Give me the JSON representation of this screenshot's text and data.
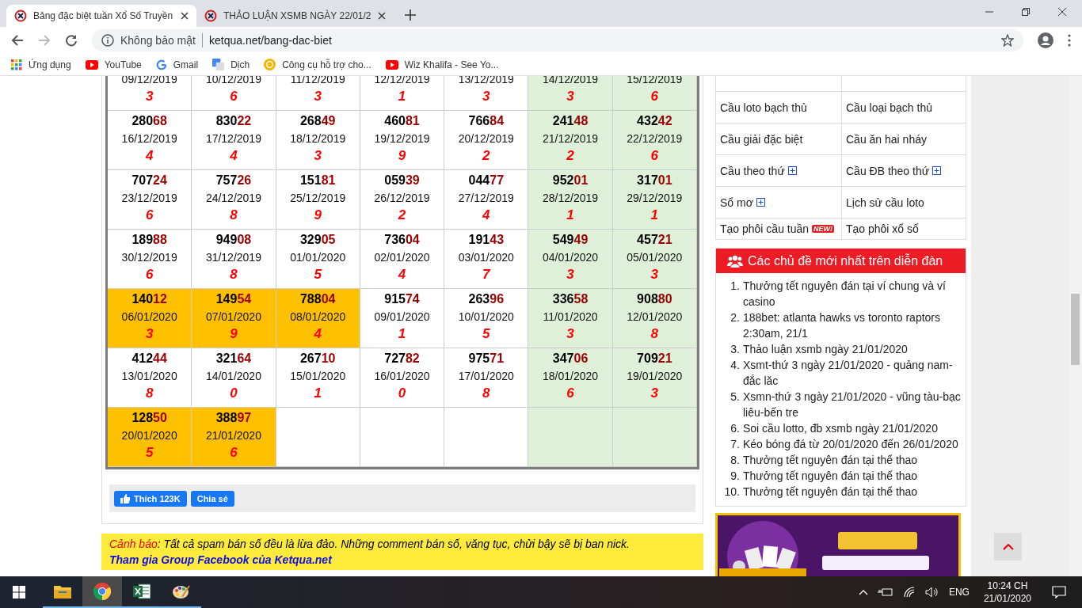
{
  "browser": {
    "tabs": [
      {
        "title": "Bảng đặc biệt tuần Xổ Số Truyền",
        "selected": true
      },
      {
        "title": "THẢO LUẬN XSMB NGÀY 22/01/2",
        "selected": false
      }
    ],
    "security": "Không bảo mật",
    "url": "ketqua.net/bang-dac-biet",
    "bookmarks": [
      {
        "kind": "apps",
        "label": "Ứng dụng"
      },
      {
        "kind": "youtube",
        "label": "YouTube"
      },
      {
        "kind": "google",
        "label": "Gmail"
      },
      {
        "kind": "translate",
        "label": "Dịch"
      },
      {
        "kind": "xs",
        "label": "Công cụ hỗ trợ cho..."
      },
      {
        "kind": "youtube",
        "label": "Wiz Khalifa - See Yo..."
      }
    ]
  },
  "results": {
    "rows": [
      {
        "cells": [
          {
            "date": "09/12/2019",
            "digit": "3",
            "highlighted": false,
            "weekend": false
          },
          {
            "date": "10/12/2019",
            "digit": "6",
            "highlighted": false,
            "weekend": false
          },
          {
            "date": "11/12/2019",
            "digit": "3",
            "highlighted": false,
            "weekend": false
          },
          {
            "date": "12/12/2019",
            "digit": "1",
            "highlighted": false,
            "weekend": false
          },
          {
            "date": "13/12/2019",
            "digit": "3",
            "highlighted": false,
            "weekend": false
          },
          {
            "date": "14/12/2019",
            "digit": "3",
            "highlighted": false,
            "weekend": true
          },
          {
            "date": "15/12/2019",
            "digit": "6",
            "highlighted": false,
            "weekend": true
          }
        ]
      },
      {
        "cells": [
          {
            "number": "28068",
            "date": "16/12/2019",
            "digit": "4",
            "highlighted": false,
            "weekend": false
          },
          {
            "number": "83022",
            "date": "17/12/2019",
            "digit": "4",
            "highlighted": false,
            "weekend": false
          },
          {
            "number": "26849",
            "date": "18/12/2019",
            "digit": "3",
            "highlighted": false,
            "weekend": false
          },
          {
            "number": "46081",
            "date": "19/12/2019",
            "digit": "9",
            "highlighted": false,
            "weekend": false
          },
          {
            "number": "76684",
            "date": "20/12/2019",
            "digit": "2",
            "highlighted": false,
            "weekend": false
          },
          {
            "number": "24148",
            "date": "21/12/2019",
            "digit": "2",
            "highlighted": false,
            "weekend": true
          },
          {
            "number": "43242",
            "date": "22/12/2019",
            "digit": "6",
            "highlighted": false,
            "weekend": true
          }
        ]
      },
      {
        "cells": [
          {
            "number": "70724",
            "date": "23/12/2019",
            "digit": "6",
            "highlighted": false,
            "weekend": false
          },
          {
            "number": "75726",
            "date": "24/12/2019",
            "digit": "8",
            "highlighted": false,
            "weekend": false
          },
          {
            "number": "15181",
            "date": "25/12/2019",
            "digit": "9",
            "highlighted": false,
            "weekend": false
          },
          {
            "number": "05939",
            "date": "26/12/2019",
            "digit": "2",
            "highlighted": false,
            "weekend": false
          },
          {
            "number": "04477",
            "date": "27/12/2019",
            "digit": "4",
            "highlighted": false,
            "weekend": false
          },
          {
            "number": "95201",
            "date": "28/12/2019",
            "digit": "1",
            "highlighted": false,
            "weekend": true
          },
          {
            "number": "31701",
            "date": "29/12/2019",
            "digit": "1",
            "highlighted": false,
            "weekend": true
          }
        ]
      },
      {
        "cells": [
          {
            "number": "18988",
            "date": "30/12/2019",
            "digit": "6",
            "highlighted": false,
            "weekend": false
          },
          {
            "number": "94908",
            "date": "31/12/2019",
            "digit": "8",
            "highlighted": false,
            "weekend": false
          },
          {
            "number": "32905",
            "date": "01/01/2020",
            "digit": "5",
            "highlighted": false,
            "weekend": false
          },
          {
            "number": "73604",
            "date": "02/01/2020",
            "digit": "4",
            "highlighted": false,
            "weekend": false
          },
          {
            "number": "19143",
            "date": "03/01/2020",
            "digit": "7",
            "highlighted": false,
            "weekend": false
          },
          {
            "number": "54949",
            "date": "04/01/2020",
            "digit": "3",
            "highlighted": false,
            "weekend": true
          },
          {
            "number": "45721",
            "date": "05/01/2020",
            "digit": "3",
            "highlighted": false,
            "weekend": true
          }
        ]
      },
      {
        "cells": [
          {
            "number": "14012",
            "date": "06/01/2020",
            "digit": "3",
            "highlighted": true,
            "weekend": false
          },
          {
            "number": "14954",
            "date": "07/01/2020",
            "digit": "9",
            "highlighted": true,
            "weekend": false
          },
          {
            "number": "78804",
            "date": "08/01/2020",
            "digit": "4",
            "highlighted": true,
            "weekend": false
          },
          {
            "number": "91574",
            "date": "09/01/2020",
            "digit": "1",
            "highlighted": false,
            "weekend": false
          },
          {
            "number": "26396",
            "date": "10/01/2020",
            "digit": "5",
            "highlighted": false,
            "weekend": false
          },
          {
            "number": "33658",
            "date": "11/01/2020",
            "digit": "3",
            "highlighted": false,
            "weekend": true
          },
          {
            "number": "90880",
            "date": "12/01/2020",
            "digit": "8",
            "highlighted": false,
            "weekend": true
          }
        ]
      },
      {
        "cells": [
          {
            "number": "41244",
            "date": "13/01/2020",
            "digit": "8",
            "highlighted": false,
            "weekend": false
          },
          {
            "number": "32164",
            "date": "14/01/2020",
            "digit": "0",
            "highlighted": false,
            "weekend": false
          },
          {
            "number": "26710",
            "date": "15/01/2020",
            "digit": "1",
            "highlighted": false,
            "weekend": false
          },
          {
            "number": "72782",
            "date": "16/01/2020",
            "digit": "0",
            "highlighted": false,
            "weekend": false
          },
          {
            "number": "97571",
            "date": "17/01/2020",
            "digit": "8",
            "highlighted": false,
            "weekend": false
          },
          {
            "number": "34706",
            "date": "18/01/2020",
            "digit": "6",
            "highlighted": false,
            "weekend": true
          },
          {
            "number": "70921",
            "date": "19/01/2020",
            "digit": "3",
            "highlighted": false,
            "weekend": true
          }
        ]
      },
      {
        "cells": [
          {
            "number": "12850",
            "date": "20/01/2020",
            "digit": "5",
            "highlighted": true,
            "weekend": false
          },
          {
            "number": "38897",
            "date": "21/01/2020",
            "digit": "6",
            "highlighted": true,
            "weekend": false
          },
          {
            "highlighted": false,
            "weekend": false
          },
          {
            "highlighted": false,
            "weekend": false
          },
          {
            "highlighted": false,
            "weekend": false
          },
          {
            "highlighted": false,
            "weekend": true
          },
          {
            "highlighted": false,
            "weekend": true
          }
        ]
      }
    ]
  },
  "share_bar": {
    "like": "Thích 123K",
    "share": "Chia sẻ"
  },
  "warning": {
    "label": "Cảnh báo",
    "text": ": Tất cả spam bán số đều là lừa đảo. Những comment bán số, văng tục, chửi bậy sẽ bị ban nick.",
    "link": "Tham gia Group Facebook của Ketqua.net"
  },
  "sidebar": {
    "menu": [
      [
        {
          "label": "Cầu loto bạch thủ",
          "expandable": false
        },
        {
          "label": "Cầu loại bạch thủ",
          "expandable": false
        }
      ],
      [
        {
          "label": "Cầu giải đặc biệt",
          "expandable": false
        },
        {
          "label": "Cầu ăn hai nháy",
          "expandable": false
        }
      ],
      [
        {
          "label": "Cầu theo thứ",
          "expandable": true
        },
        {
          "label": "Cầu ĐB theo thứ",
          "expandable": true
        }
      ],
      [
        {
          "label": "Sổ mơ",
          "expandable": true
        },
        {
          "label": "Lịch sử cầu loto",
          "expandable": false
        }
      ],
      [
        {
          "label": "Tạo phôi cầu tuần",
          "expandable": false,
          "badge": "NEW!"
        },
        {
          "label": "Tạo phôi xổ số",
          "expandable": false
        }
      ]
    ],
    "forum": {
      "title": "Các chủ đề mới nhất trên diễn đàn",
      "items": [
        {
          "number": "1.",
          "text": "Thưởng tết nguyên đán tại ví chung và ví casino"
        },
        {
          "number": "2.",
          "text": "188bet: atlanta hawks vs toronto raptors 2:30am, 21/1"
        },
        {
          "number": "3.",
          "text": "Thảo luận xsmb ngày 21/01/2020"
        },
        {
          "number": "4.",
          "text": "Xsmt-thứ 3 ngày 21/01/2020 - quảng nam-đắc lăc"
        },
        {
          "number": "5.",
          "text": "Xsmn-thứ 3 ngày 21/01/2020 - vũng tàu-bạc liêu-bến tre"
        },
        {
          "number": "6.",
          "text": "Soi cầu lotto, đb xsmb ngày 21/01/2020"
        },
        {
          "number": "7.",
          "text": "Kéo bóng đá từ 20/01/2020 đến 26/01/2020"
        },
        {
          "number": "8.",
          "text": "Thưởng tết nguyên đán tại thể thao"
        },
        {
          "number": "9.",
          "text": "Thưởng tết nguyên đán tại thể thao"
        },
        {
          "number": "10.",
          "text": "Thưởng tết nguyên đán tại thể thao"
        }
      ]
    }
  },
  "taskbar": {
    "apps": [
      {
        "kind": "explorer",
        "active": false
      },
      {
        "kind": "chrome",
        "active": true
      },
      {
        "kind": "excel",
        "active": false
      },
      {
        "kind": "paint",
        "active": false
      }
    ],
    "language": "ENG",
    "time": "10:24 CH",
    "date": "21/01/2020"
  }
}
